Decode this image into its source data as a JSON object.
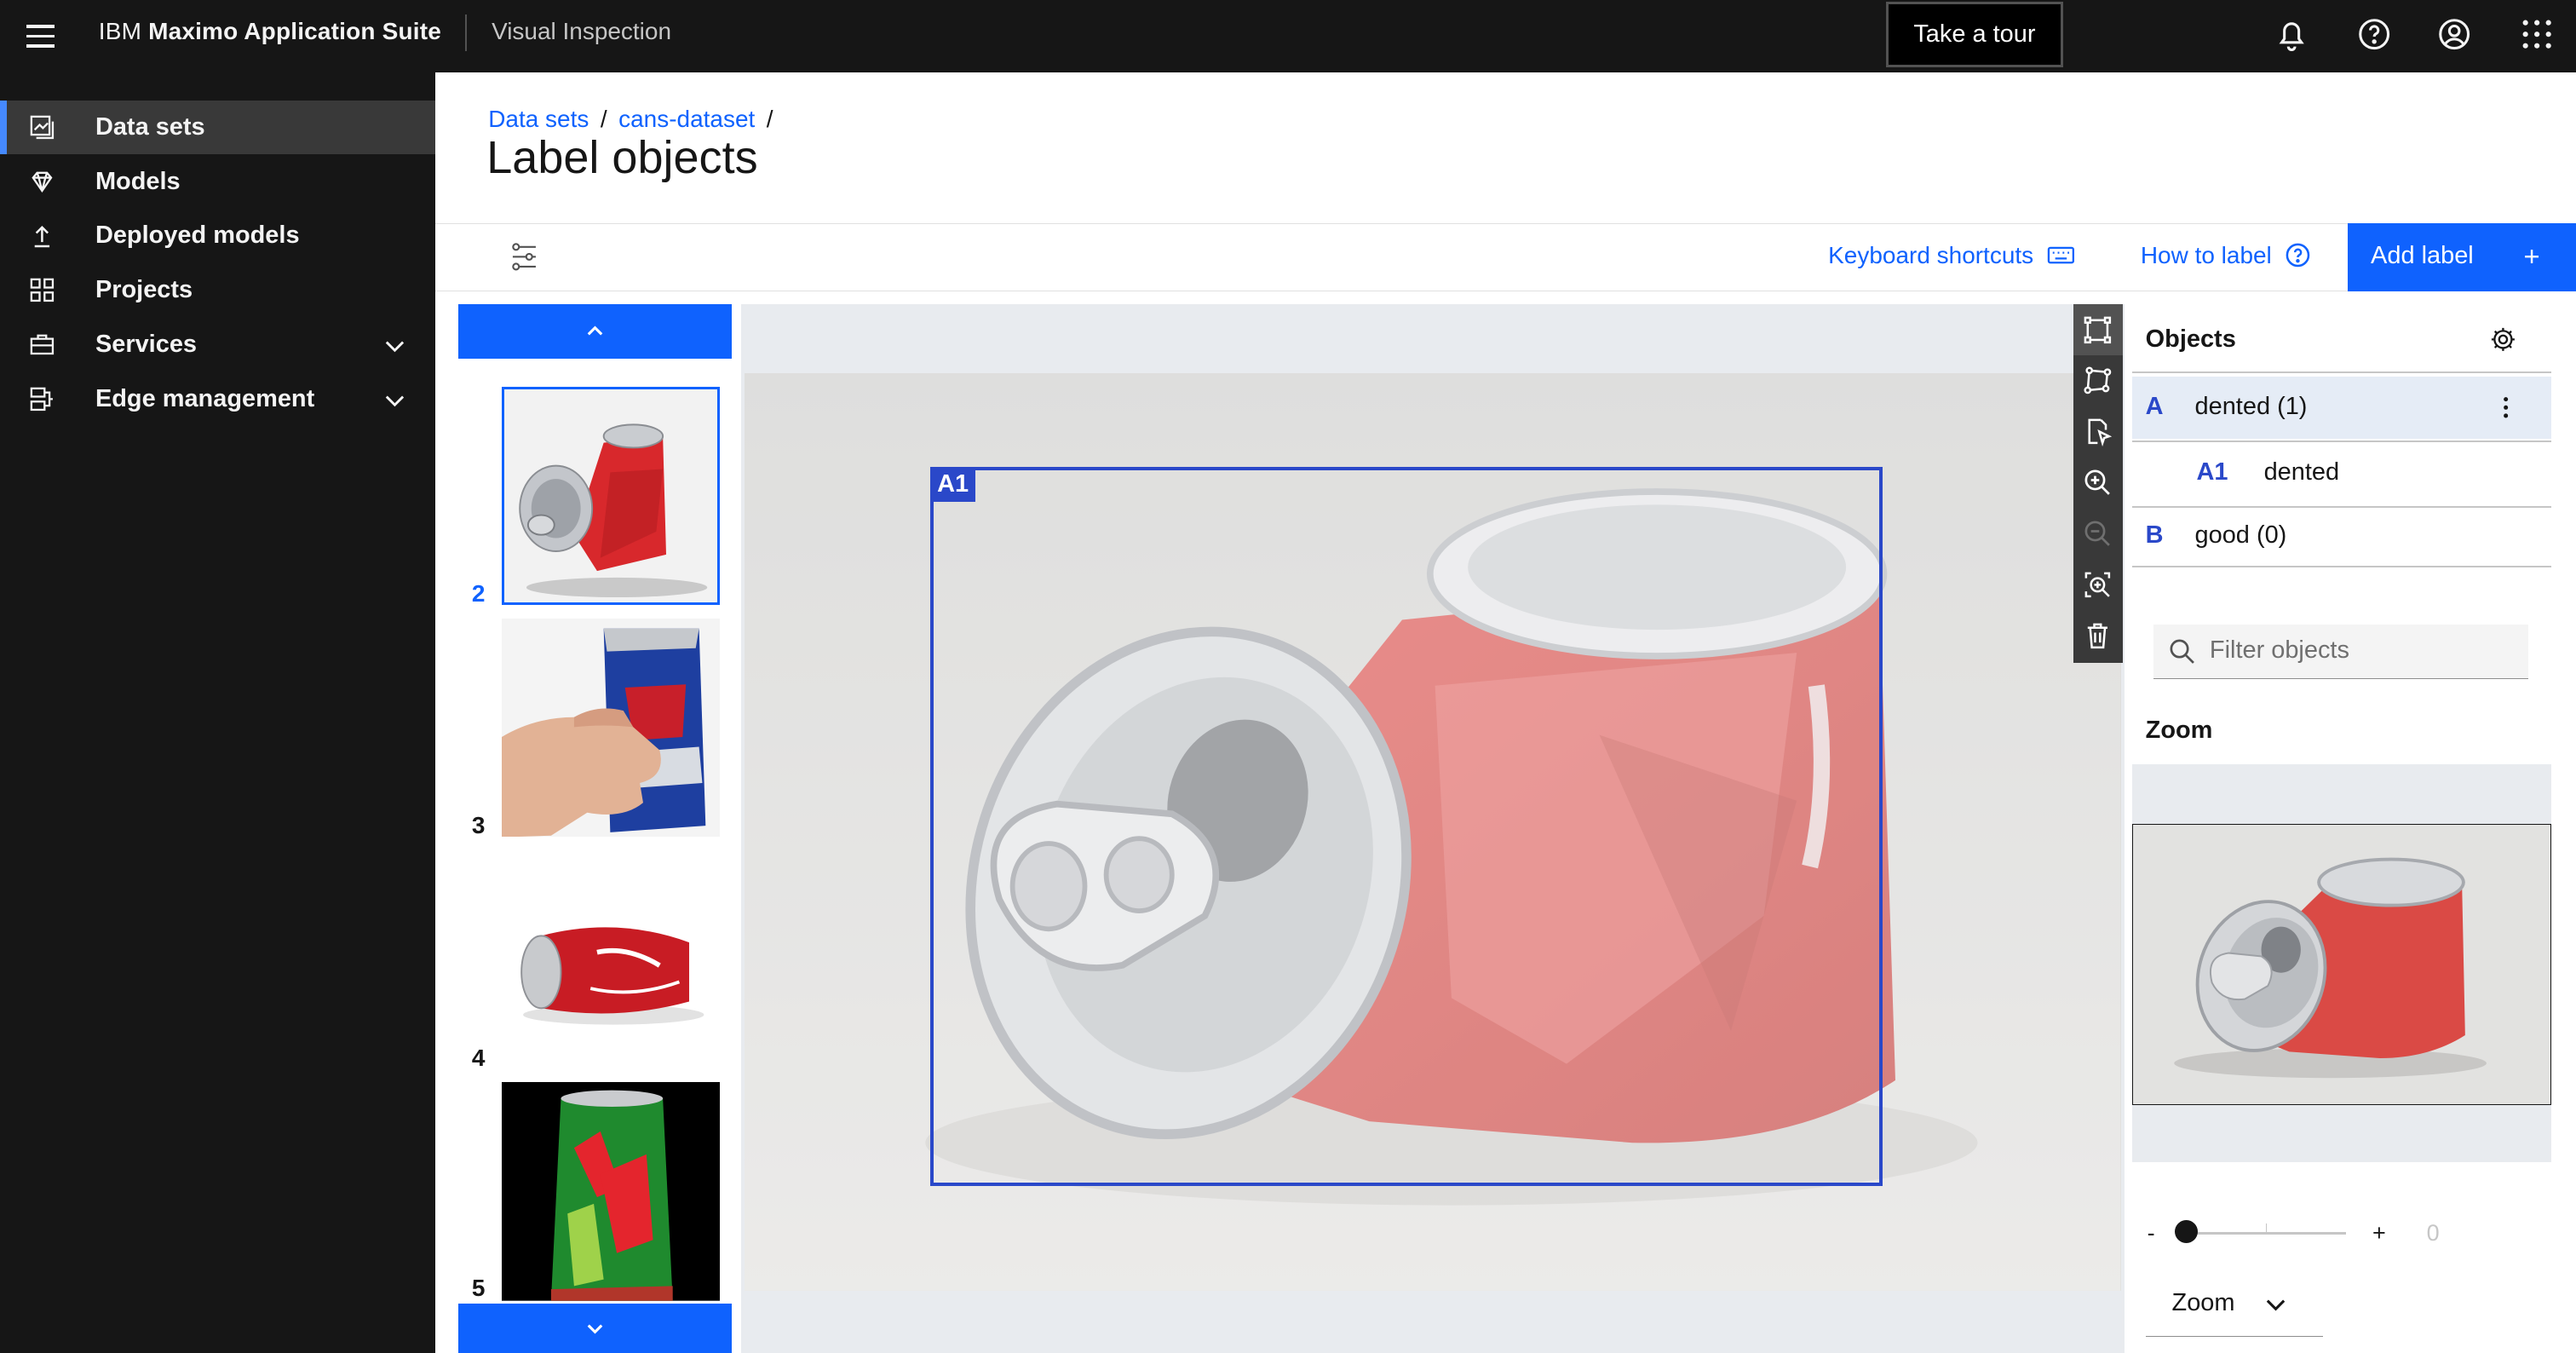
{
  "header": {
    "brand_prefix": "IBM",
    "brand_name": "Maximo Application Suite",
    "product": "Visual Inspection",
    "tour_button": "Take a tour",
    "icons": [
      "notification-icon",
      "help-icon",
      "user-avatar-icon",
      "app-switcher-icon"
    ]
  },
  "sidebar": {
    "items": [
      {
        "label": "Data sets",
        "icon": "data-sets-icon",
        "active": true
      },
      {
        "label": "Models",
        "icon": "model-icon"
      },
      {
        "label": "Deployed models",
        "icon": "deploy-icon"
      },
      {
        "label": "Projects",
        "icon": "projects-icon"
      },
      {
        "label": "Services",
        "icon": "services-icon",
        "expandable": true
      },
      {
        "label": "Edge management",
        "icon": "edge-icon",
        "expandable": true
      }
    ]
  },
  "breadcrumb": {
    "items": [
      "Data sets",
      "cans-dataset"
    ],
    "separator": "/"
  },
  "page": {
    "title": "Label objects"
  },
  "toolbar": {
    "keyboard_shortcuts": "Keyboard shortcuts",
    "how_to_label": "How to label",
    "add_label": "Add label",
    "add_label_icon": "+"
  },
  "thumbnails": {
    "items": [
      {
        "number": "2",
        "selected": true,
        "subject": "crushed red can"
      },
      {
        "number": "3",
        "subject": "hand crushing blue can"
      },
      {
        "number": "4",
        "subject": "red can on side"
      },
      {
        "number": "5",
        "subject": "green can"
      }
    ]
  },
  "canvas": {
    "box_label": "A1"
  },
  "objects": {
    "title": "Objects",
    "labels": [
      {
        "key": "A",
        "name": "dented (1)",
        "children": [
          {
            "key": "A1",
            "name": "dented"
          }
        ]
      },
      {
        "key": "B",
        "name": "good (0)",
        "children": []
      }
    ],
    "filter_placeholder": "Filter objects"
  },
  "zoom": {
    "title": "Zoom",
    "min_label": "-",
    "max_label": "+",
    "value": "0",
    "select_value": "Zoom"
  },
  "colors": {
    "accent": "#0f62fe",
    "label": "#2a48c9",
    "header": "#161616"
  }
}
